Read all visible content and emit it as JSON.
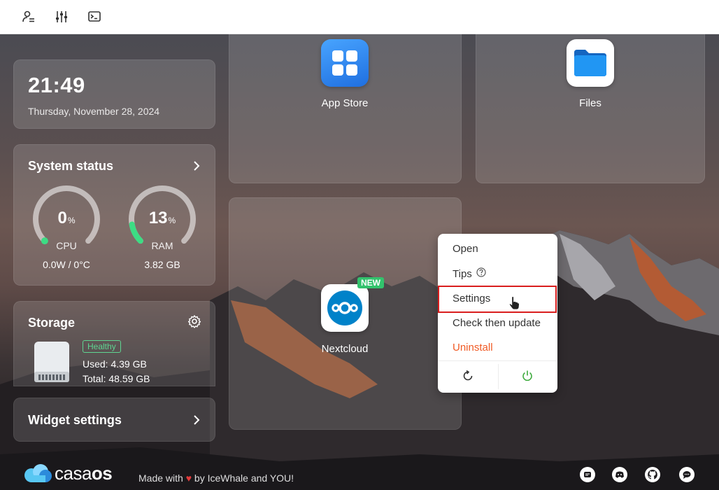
{
  "toolbar": {
    "icons": [
      "account-settings-icon",
      "sliders-icon",
      "terminal-icon"
    ]
  },
  "clock": {
    "time": "21:49",
    "date": "Thursday, November 28, 2024"
  },
  "system_status": {
    "title": "System status",
    "cpu": {
      "value": "0",
      "unit": "%",
      "label": "CPU",
      "sub": "0.0W / 0°C",
      "percent": 0
    },
    "ram": {
      "value": "13",
      "unit": "%",
      "label": "RAM",
      "sub": "3.82 GB",
      "percent": 13
    },
    "accent_color": "#3ddc84"
  },
  "storage": {
    "title": "Storage",
    "status": "Healthy",
    "used": "Used: 4.39 GB",
    "total": "Total: 48.59 GB"
  },
  "widget_settings": {
    "title": "Widget settings"
  },
  "apps": [
    {
      "name": "App Store",
      "icon": "app-store-icon",
      "color": "#2f8cf0"
    },
    {
      "name": "Files",
      "icon": "folder-icon",
      "color": "#1e88e5"
    },
    {
      "name": "Nextcloud",
      "icon": "nextcloud-icon",
      "color": "#0082c9",
      "badge": "NEW"
    }
  ],
  "context_menu": {
    "items": [
      "Open",
      "Tips",
      "Settings",
      "Check then update",
      "Uninstall"
    ],
    "uninstall_color": "#f05a24",
    "highlighted": "Settings",
    "actions": [
      "restart-icon",
      "power-icon"
    ]
  },
  "footer": {
    "brand_prefix": "casa",
    "brand_suffix": "os",
    "made_with_prefix": "Made with",
    "made_with_suffix": "by IceWhale and YOU!",
    "icons": [
      "message-icon",
      "discord-icon",
      "github-icon",
      "chat-bubble-icon"
    ]
  }
}
